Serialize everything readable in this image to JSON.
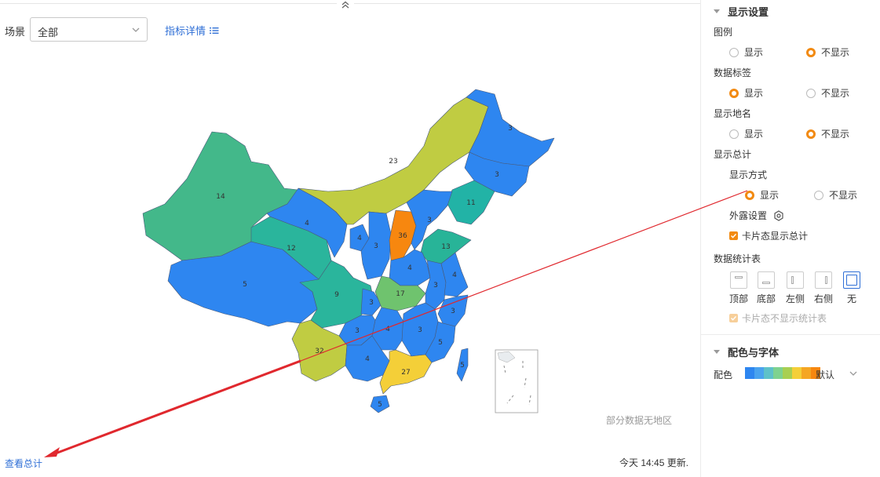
{
  "filter": {
    "label": "场景",
    "select_value": "全部",
    "detail_link": "指标详情"
  },
  "map": {
    "regions": [
      {
        "id": "xinjiang",
        "value": "14",
        "color": "#43b88a"
      },
      {
        "id": "xizang",
        "value": "5",
        "color": "#2e86f0"
      },
      {
        "id": "qinghai",
        "value": "12",
        "color": "#2ab59c"
      },
      {
        "id": "gansu",
        "value": "4",
        "color": "#2e86f0"
      },
      {
        "id": "neimenggu",
        "value": "23",
        "color": "#c0cc42"
      },
      {
        "id": "heilongjiang",
        "value": "3",
        "color": "#2e86f0"
      },
      {
        "id": "jilin",
        "value": "3",
        "color": "#2e86f0"
      },
      {
        "id": "liaoning",
        "value": "11",
        "color": "#22b3a6"
      },
      {
        "id": "ningxia",
        "value": "4",
        "color": "#2e86f0"
      },
      {
        "id": "shaanxi",
        "value": "3",
        "color": "#2e86f0"
      },
      {
        "id": "shanxi",
        "value": "36",
        "color": "#f7870f"
      },
      {
        "id": "hebei",
        "value": "3",
        "color": "#2e86f0"
      },
      {
        "id": "shandong",
        "value": "13",
        "color": "#28b498"
      },
      {
        "id": "henan",
        "value": "4",
        "color": "#2e86f0"
      },
      {
        "id": "sichuan",
        "value": "9",
        "color": "#2ab59c"
      },
      {
        "id": "chongqing",
        "value": "3",
        "color": "#2e86f0"
      },
      {
        "id": "hubei",
        "value": "17",
        "color": "#6fc36e"
      },
      {
        "id": "anhui",
        "value": "3",
        "color": "#2e86f0"
      },
      {
        "id": "jiangsu",
        "value": "4",
        "color": "#2e86f0"
      },
      {
        "id": "zhejiang",
        "value": "3",
        "color": "#2e86f0"
      },
      {
        "id": "hunan",
        "value": "4",
        "color": "#2e86f0"
      },
      {
        "id": "jiangxi",
        "value": "3",
        "color": "#2e86f0"
      },
      {
        "id": "guizhou",
        "value": "3",
        "color": "#2e86f0"
      },
      {
        "id": "yunnan",
        "value": "32",
        "color": "#c0cc42"
      },
      {
        "id": "guangxi",
        "value": "4",
        "color": "#2e86f0"
      },
      {
        "id": "guangdong",
        "value": "27",
        "color": "#f4cf38"
      },
      {
        "id": "fujian",
        "value": "5",
        "color": "#2e86f0"
      },
      {
        "id": "taiwan",
        "value": "5",
        "color": "#2e86f0"
      },
      {
        "id": "hainan",
        "value": "5",
        "color": "#2e86f0"
      }
    ]
  },
  "footer": {
    "no_region_note": "部分数据无地区",
    "view_total": "查看总计",
    "update_time": "今天 14:45 更新."
  },
  "panel": {
    "display_settings": {
      "title": "显示设置",
      "legend": {
        "label": "图例",
        "options": [
          "显示",
          "不显示"
        ],
        "selected": "不显示"
      },
      "data_label": {
        "label": "数据标签",
        "options": [
          "显示",
          "不显示"
        ],
        "selected": "显示"
      },
      "place_name": {
        "label": "显示地名",
        "options": [
          "显示",
          "不显示"
        ],
        "selected": "不显示"
      },
      "total": {
        "label": "显示总计",
        "mode_label": "显示方式",
        "options": [
          "显示",
          "不显示"
        ],
        "selected": "显示",
        "expose_label": "外露设置",
        "card_total": "卡片态显示总计"
      },
      "stats_table": {
        "label": "数据统计表",
        "positions": [
          "顶部",
          "底部",
          "左侧",
          "右侧",
          "无"
        ],
        "selected": "无",
        "card_no_table": "卡片态不显示统计表"
      }
    },
    "color_font": {
      "title": "配色与字体",
      "palette_label": "配色",
      "palette_name": "默认",
      "palette_colors": [
        "#2e86f0",
        "#4aa3ee",
        "#5ec1c9",
        "#7ed28f",
        "#a8cf52",
        "#f4cf38",
        "#f5a623",
        "#f7870f"
      ]
    }
  }
}
